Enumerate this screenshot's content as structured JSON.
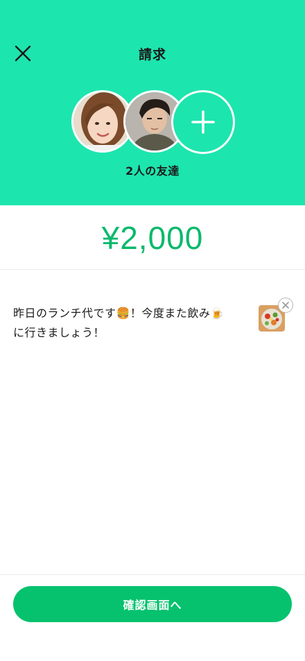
{
  "header": {
    "title": "請求",
    "close_icon": "close-icon",
    "background_color": "#1de5ae"
  },
  "recipients": {
    "count_label": "2人の友達",
    "avatars": [
      "friend-avatar-woman",
      "friend-avatar-man"
    ],
    "add_icon": "plus-icon"
  },
  "amount": {
    "value": "¥2,000",
    "color": "#0bb96c"
  },
  "message": {
    "text": "昨日のランチ代です🍔！今度また飲み🍺\nに行きましょう！",
    "attachment_icon": "salad-photo-thumbnail",
    "remove_icon": "close-circle-icon"
  },
  "footer": {
    "confirm_label": "確認画面へ",
    "button_color": "#06c26e"
  }
}
